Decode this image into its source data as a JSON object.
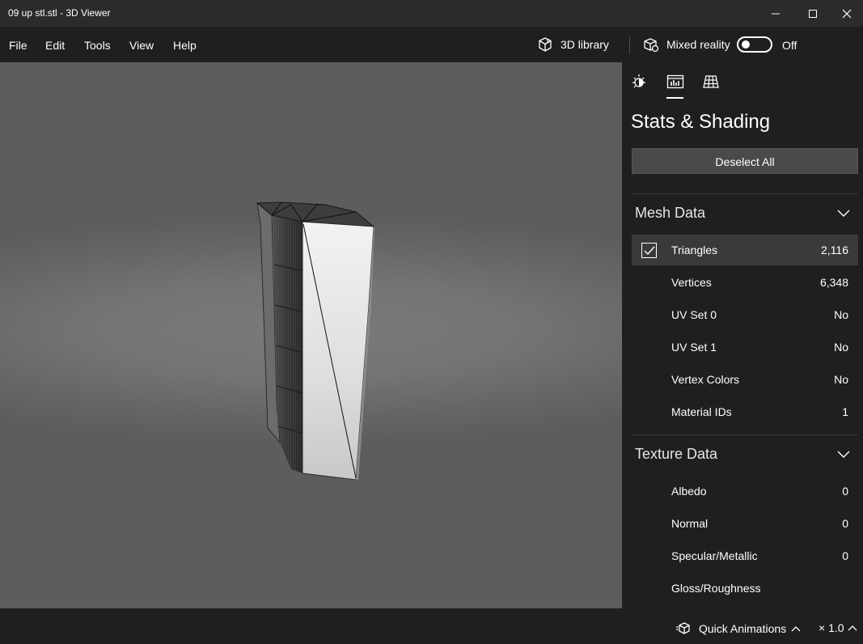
{
  "window": {
    "title": "09 up stl.stl - 3D Viewer"
  },
  "menu": {
    "items": [
      "File",
      "Edit",
      "Tools",
      "View",
      "Help"
    ]
  },
  "toolbar": {
    "library_label": "3D library",
    "mixed_reality_label": "Mixed reality",
    "mixed_reality_state": "Off",
    "mixed_reality_on": false
  },
  "panel": {
    "tabs": [
      {
        "icon": "lighting-icon"
      },
      {
        "icon": "stats-icon",
        "active": true
      },
      {
        "icon": "grid-icon"
      }
    ],
    "title": "Stats & Shading",
    "deselect_label": "Deselect All",
    "mesh_data": {
      "heading": "Mesh Data",
      "rows": [
        {
          "label": "Triangles",
          "value": "2,116",
          "checked": true
        },
        {
          "label": "Vertices",
          "value": "6,348"
        },
        {
          "label": "UV Set 0",
          "value": "No"
        },
        {
          "label": "UV Set 1",
          "value": "No"
        },
        {
          "label": "Vertex Colors",
          "value": "No"
        },
        {
          "label": "Material IDs",
          "value": "1"
        }
      ]
    },
    "texture_data": {
      "heading": "Texture Data",
      "rows": [
        {
          "label": "Albedo",
          "value": "0"
        },
        {
          "label": "Normal",
          "value": "0"
        },
        {
          "label": "Specular/Metallic",
          "value": "0"
        },
        {
          "label": "Gloss/Roughness",
          "value": ""
        }
      ]
    }
  },
  "bottom": {
    "quick_animations_label": "Quick Animations",
    "speed_label": "× 1.0"
  },
  "colors": {
    "accent": "#ffffff",
    "panel_bg": "#1f1f1f",
    "selected_row": "#3a3a3a",
    "button_bg": "#4a4a4a"
  }
}
